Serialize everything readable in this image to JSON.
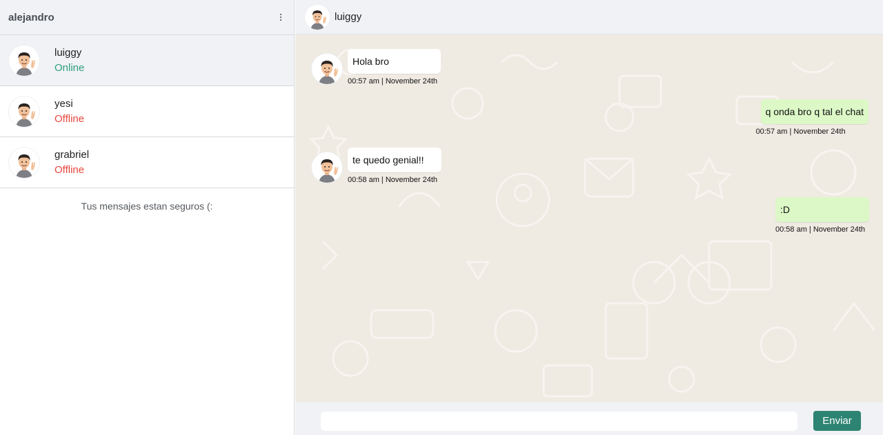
{
  "sidebar": {
    "user": "alejandro",
    "contacts": [
      {
        "name": "luiggy",
        "status": "Online"
      },
      {
        "name": "yesi",
        "status": "Offline"
      },
      {
        "name": "grabriel",
        "status": "Offline"
      }
    ],
    "secure_note": "Tus mensajes estan seguros (:"
  },
  "chat": {
    "contact_name": "luiggy",
    "messages": [
      {
        "text": "Hola bro",
        "time": "00:57 am | November 24th",
        "direction": "in"
      },
      {
        "text": "q onda bro q tal el chat",
        "time": "00:57 am | November 24th",
        "direction": "out"
      },
      {
        "text": "te quedo genial!!",
        "time": "00:58 am | November 24th",
        "direction": "in"
      },
      {
        "text": ":D",
        "time": "00:58 am | November 24th",
        "direction": "out"
      }
    ],
    "input_value": "",
    "send_label": "Enviar"
  },
  "icons": {
    "menu": "kebab-menu-icon",
    "avatar": "memoji-avatar-icon"
  },
  "colors": {
    "online": "#2f9e7e",
    "offline": "#e5473d",
    "send_button": "#2e8473",
    "outgoing_bubble": "#dcf8c6",
    "chat_background": "#efeae2"
  }
}
